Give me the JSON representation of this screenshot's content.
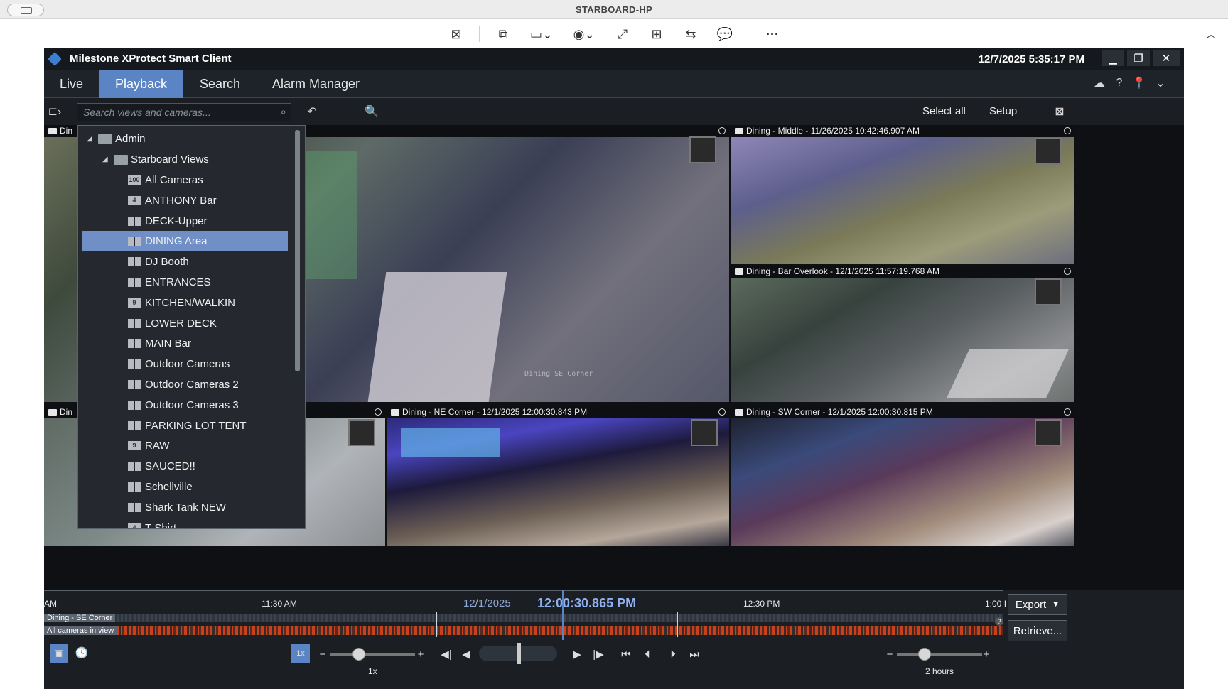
{
  "remote": {
    "title": "STARBOARD-HP"
  },
  "app": {
    "name": "Milestone XProtect Smart Client",
    "datetime": "12/7/2025 5:35:17 PM",
    "tabs": [
      "Live",
      "Playback",
      "Search",
      "Alarm Manager"
    ],
    "active_tab": "Playback"
  },
  "viewbar": {
    "search_placeholder": "Search views and cameras...",
    "select_all": "Select all",
    "setup": "Setup"
  },
  "tree": {
    "root": "Admin",
    "group": "Starboard Views",
    "items": [
      {
        "label": "All Cameras",
        "badge": "100"
      },
      {
        "label": "ANTHONY Bar",
        "badge": "4"
      },
      {
        "label": "DECK-Upper",
        "badge": ""
      },
      {
        "label": "DINING Area",
        "badge": ""
      },
      {
        "label": "DJ Booth",
        "badge": ""
      },
      {
        "label": "ENTRANCES",
        "badge": ""
      },
      {
        "label": "KITCHEN/WALKIN",
        "badge": "9"
      },
      {
        "label": "LOWER DECK",
        "badge": ""
      },
      {
        "label": "MAIN Bar",
        "badge": ""
      },
      {
        "label": "Outdoor Cameras",
        "badge": ""
      },
      {
        "label": "Outdoor Cameras 2",
        "badge": ""
      },
      {
        "label": "Outdoor Cameras 3",
        "badge": ""
      },
      {
        "label": "PARKING LOT TENT",
        "badge": ""
      },
      {
        "label": "RAW",
        "badge": "9"
      },
      {
        "label": "SAUCED!!",
        "badge": ""
      },
      {
        "label": "Schellville",
        "badge": ""
      },
      {
        "label": "Shark Tank NEW",
        "badge": ""
      },
      {
        "label": "T-Shirt",
        "badge": "4"
      }
    ],
    "selected": "DINING Area"
  },
  "cameras": {
    "tl_head": "Din",
    "bl_head": "Din",
    "middle_right": "Dining - Middle - 11/26/2025 10:42:46.907 AM",
    "bar_overlook": "Dining - Bar Overlook - 12/1/2025 11:57:19.768 AM",
    "ne_corner": "Dining - NE Corner - 12/1/2025 12:00:30.843 PM",
    "sw_corner": "Dining - SW Corner - 12/1/2025 12:00:30.815 PM",
    "overlay_se": "Dining  SE Corner"
  },
  "timeline": {
    "tick_am": "AM",
    "tick_1130": "11:30 AM",
    "date": "12/1/2025",
    "current_time": "12:00:30.865 PM",
    "tick_1230": "12:30 PM",
    "tick_100": "1:00 I",
    "track1": "Dining - SE Corner",
    "track2": "All cameras in view",
    "export": "Export",
    "retrieve": "Retrieve...",
    "speed_badge": "1x",
    "speed_label": "1x",
    "span_label": "2 hours",
    "help": "?"
  },
  "colors": {
    "accent": "#5b84c4",
    "recording": "#c8411d"
  }
}
